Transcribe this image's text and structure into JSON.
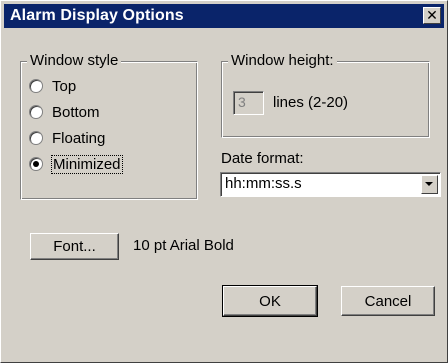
{
  "dialog": {
    "title": "Alarm Display Options",
    "close_glyph": "✕"
  },
  "window_style": {
    "label": "Window style",
    "options": [
      {
        "label": "Top",
        "checked": false
      },
      {
        "label": "Bottom",
        "checked": false
      },
      {
        "label": "Floating",
        "checked": false
      },
      {
        "label": "Minimized",
        "checked": true
      }
    ]
  },
  "window_height": {
    "label": "Window height:",
    "value": "3",
    "units_label": "lines (2-20)",
    "enabled": false
  },
  "date_format": {
    "label": "Date format:",
    "value": "hh:mm:ss.s"
  },
  "font": {
    "button_label": "Font...",
    "current_font": "10 pt Arial Bold"
  },
  "actions": {
    "ok_label": "OK",
    "cancel_label": "Cancel"
  }
}
